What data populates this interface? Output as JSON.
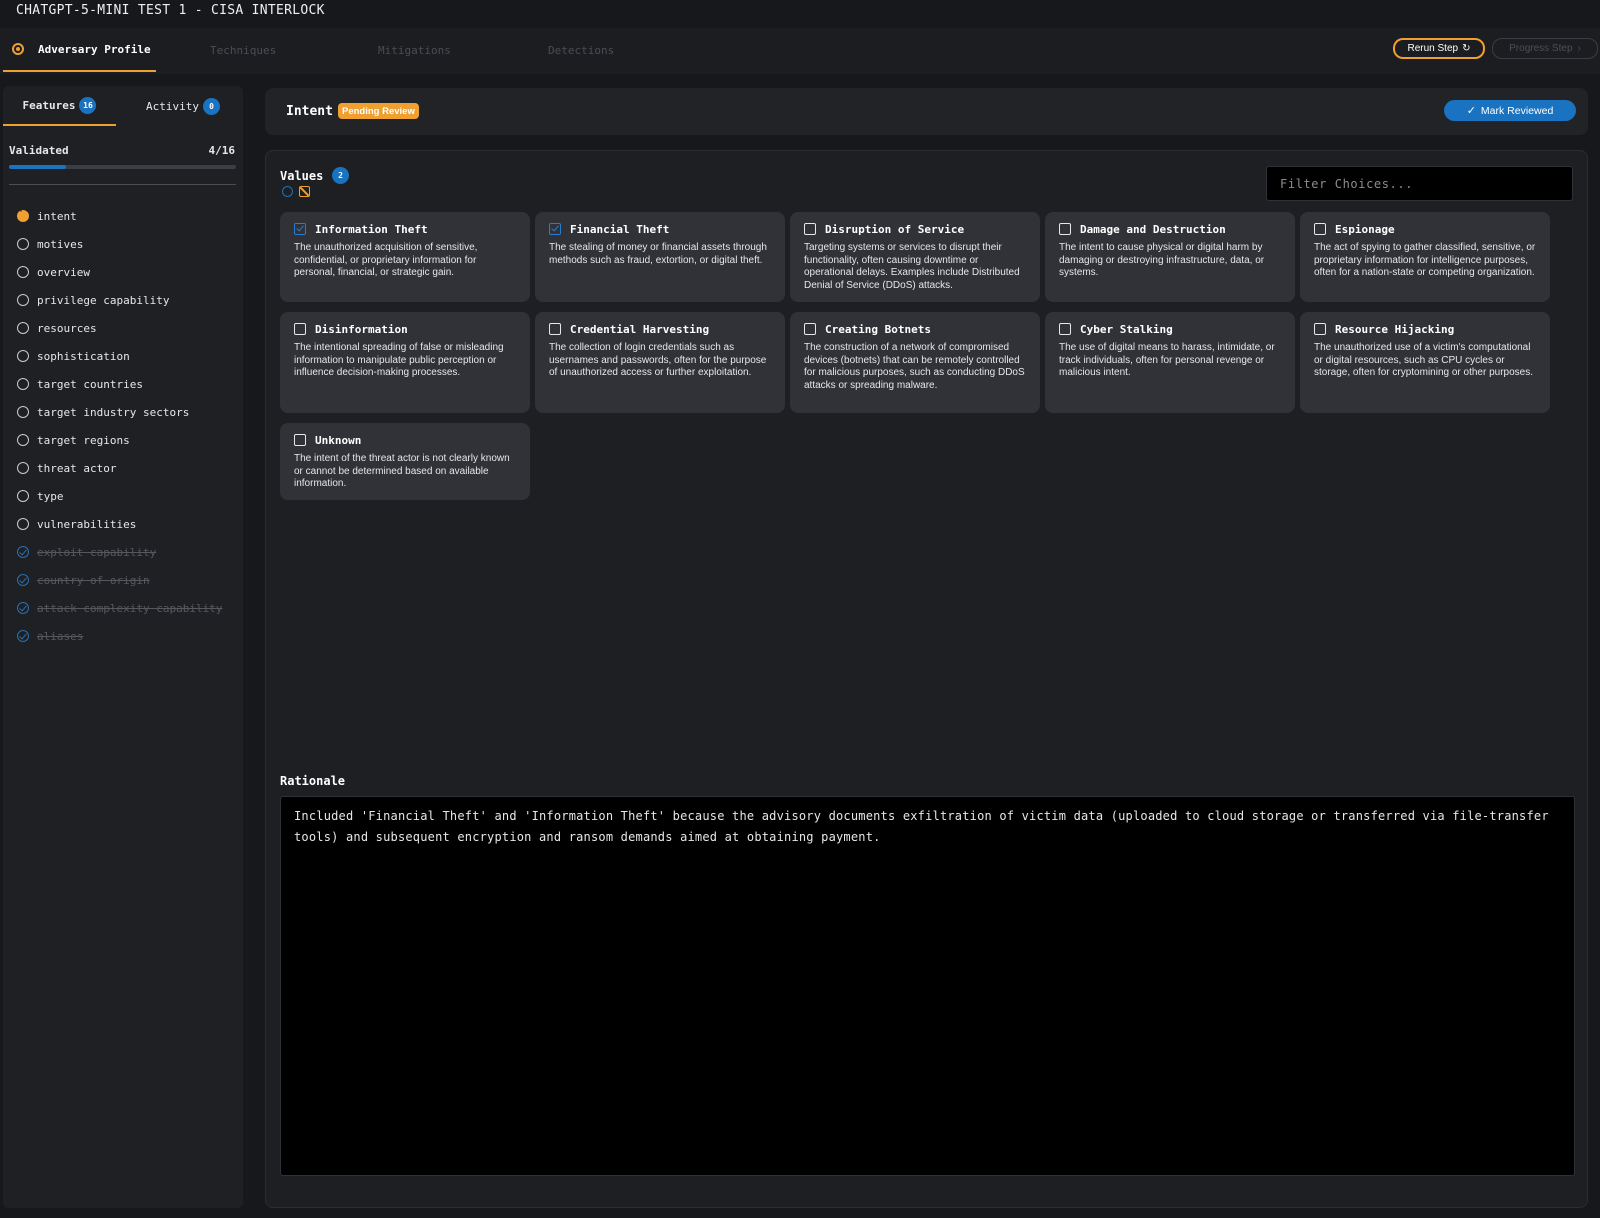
{
  "app": {
    "title": "CHATGPT-5-MINI TEST 1 - CISA INTERLOCK"
  },
  "nav": {
    "steps": [
      {
        "label": "Adversary Profile",
        "state": "active"
      },
      {
        "label": "Techniques",
        "state": "inactive"
      },
      {
        "label": "Mitigations",
        "state": "inactive"
      },
      {
        "label": "Detections",
        "state": "inactive"
      }
    ],
    "rerun_label": "Rerun Step",
    "progress_label": "Progress Step"
  },
  "sidebar": {
    "tabs": {
      "features_label": "Features",
      "features_count": "16",
      "activity_label": "Activity",
      "activity_count": "0"
    },
    "validated_label": "Validated",
    "validated_count": "4/16",
    "validated_fraction": 0.25,
    "features": [
      {
        "label": "intent",
        "status": "current"
      },
      {
        "label": "motives",
        "status": "open"
      },
      {
        "label": "overview",
        "status": "open"
      },
      {
        "label": "privilege capability",
        "status": "open"
      },
      {
        "label": "resources",
        "status": "open"
      },
      {
        "label": "sophistication",
        "status": "open"
      },
      {
        "label": "target countries",
        "status": "open"
      },
      {
        "label": "target industry sectors",
        "status": "open"
      },
      {
        "label": "target regions",
        "status": "open"
      },
      {
        "label": "threat actor",
        "status": "open"
      },
      {
        "label": "type",
        "status": "open"
      },
      {
        "label": "vulnerabilities",
        "status": "open"
      },
      {
        "label": "exploit capability",
        "status": "done"
      },
      {
        "label": "country of origin",
        "status": "done"
      },
      {
        "label": "attack complexity capability",
        "status": "done"
      },
      {
        "label": "aliases",
        "status": "done"
      }
    ]
  },
  "header": {
    "title": "Intent",
    "status_badge": "Pending Review",
    "mark_reviewed_label": "Mark Reviewed"
  },
  "values": {
    "title": "Values",
    "count": "2",
    "filter_placeholder": "Filter Choices...",
    "choices": [
      {
        "title": "Information Theft",
        "checked": true,
        "description": "The unauthorized acquisition of sensitive, confidential, or proprietary information for personal, financial, or strategic gain."
      },
      {
        "title": "Financial Theft",
        "checked": true,
        "description": "The stealing of money or financial assets through methods such as fraud, extortion, or digital theft."
      },
      {
        "title": "Disruption of Service",
        "checked": false,
        "description": "Targeting systems or services to disrupt their functionality, often causing downtime or operational delays. Examples include Distributed Denial of Service (DDoS) attacks."
      },
      {
        "title": "Damage and Destruction",
        "checked": false,
        "description": "The intent to cause physical or digital harm by damaging or destroying infrastructure, data, or systems."
      },
      {
        "title": "Espionage",
        "checked": false,
        "description": "The act of spying to gather classified, sensitive, or proprietary information for intelligence purposes, often for a nation-state or competing organization."
      },
      {
        "title": "Disinformation",
        "checked": false,
        "description": "The intentional spreading of false or misleading information to manipulate public perception or influence decision-making processes."
      },
      {
        "title": "Credential Harvesting",
        "checked": false,
        "description": "The collection of login credentials such as usernames and passwords, often for the purpose of unauthorized access or further exploitation."
      },
      {
        "title": "Creating Botnets",
        "checked": false,
        "description": "The construction of a network of compromised devices (botnets) that can be remotely controlled for malicious purposes, such as conducting DDoS attacks or spreading malware."
      },
      {
        "title": "Cyber Stalking",
        "checked": false,
        "description": "The use of digital means to harass, intimidate, or track individuals, often for personal revenge or malicious intent."
      },
      {
        "title": "Resource Hijacking",
        "checked": false,
        "description": "The unauthorized use of a victim's computational or digital resources, such as CPU cycles or storage, often for cryptomining or other purposes."
      },
      {
        "title": "Unknown",
        "checked": false,
        "description": "The intent of the threat actor is not clearly known or cannot be determined based on available information."
      }
    ]
  },
  "rationale": {
    "label": "Rationale",
    "text": "Included 'Financial Theft' and 'Information Theft' because the advisory documents exfiltration of victim data (uploaded to cloud storage or transferred via file-transfer tools) and subsequent encryption and ransom demands aimed at obtaining payment."
  },
  "colors": {
    "accent": "#f0a030",
    "primary": "#1a73c0",
    "background": "#16181c"
  }
}
